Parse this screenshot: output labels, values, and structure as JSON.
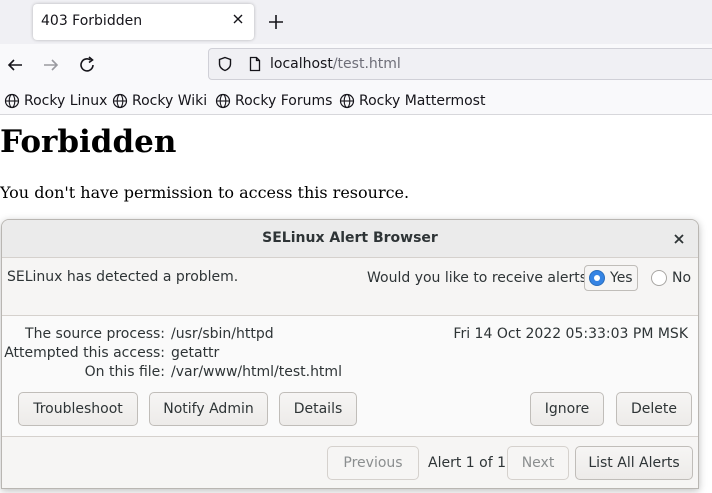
{
  "tabbar": {
    "tab_title": "403 Forbidden"
  },
  "navbar": {
    "url_host": "localhost",
    "url_path": "/test.html"
  },
  "bookmarks": [
    {
      "label": "Rocky Linux"
    },
    {
      "label": "Rocky Wiki"
    },
    {
      "label": "Rocky Forums"
    },
    {
      "label": "Rocky Mattermost"
    }
  ],
  "page": {
    "heading": "Forbidden",
    "message": "You don't have permission to access this resource."
  },
  "dialog": {
    "title": "SELinux Alert Browser",
    "detected_text": "SELinux has detected a problem.",
    "alert_question": "Would you like to receive alerts?",
    "yes_label": "Yes",
    "no_label": "No",
    "yes_checked": true,
    "source_process_label": "The source process:",
    "source_process_value": "/usr/sbin/httpd",
    "access_label": "Attempted this access:",
    "access_value": "getattr",
    "file_label": "On this file:",
    "file_value": "/var/www/html/test.html",
    "timestamp": "Fri 14 Oct 2022 05:33:03 PM MSK",
    "buttons": {
      "troubleshoot": "Troubleshoot",
      "notify_admin": "Notify Admin",
      "details": "Details",
      "ignore": "Ignore",
      "delete": "Delete",
      "previous": "Previous",
      "next": "Next",
      "list_all": "List All Alerts"
    },
    "pager_text": "Alert 1 of 1"
  },
  "colors": {
    "accent": "#3584e4",
    "dialog_bg": "#f6f5f4"
  }
}
